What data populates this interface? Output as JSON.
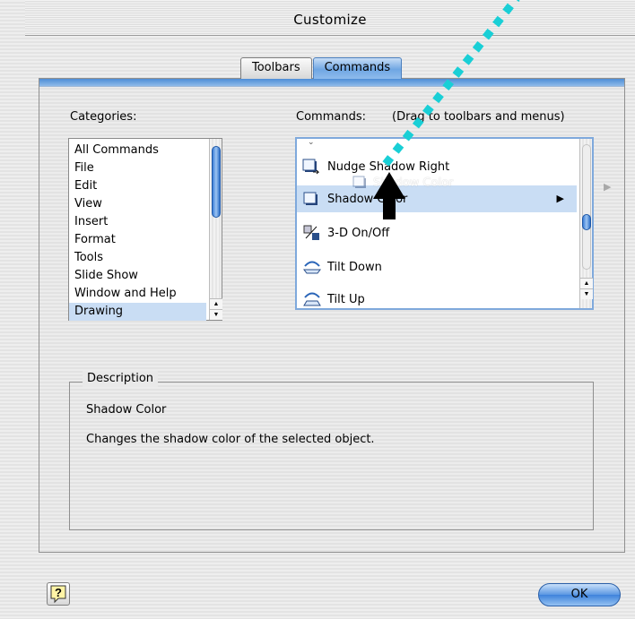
{
  "window": {
    "title": "Customize"
  },
  "tabs": [
    {
      "label": "Toolbars",
      "active": false
    },
    {
      "label": "Commands",
      "active": true
    }
  ],
  "categories": {
    "label": "Categories:",
    "items": [
      "All Commands",
      "File",
      "Edit",
      "View",
      "Insert",
      "Format",
      "Tools",
      "Slide Show",
      "Window and Help",
      "Drawing"
    ],
    "selected": "Drawing"
  },
  "commands": {
    "label": "Commands:",
    "hint": "(Drag to toolbars and menus)",
    "items": [
      {
        "label": "Nudge Shadow Right",
        "icon": "nudge-shadow-right-icon"
      },
      {
        "label": "Shadow Color",
        "icon": "shadow-color-icon",
        "has_submenu": true,
        "selected": true
      },
      {
        "label": "3-D On/Off",
        "icon": "3d-icon"
      },
      {
        "label": "Tilt Down",
        "icon": "tilt-down-icon"
      },
      {
        "label": "Tilt Up",
        "icon": "tilt-up-icon"
      }
    ],
    "drag_ghost_label": "Shadow Color"
  },
  "description": {
    "legend": "Description",
    "name": "Shadow Color",
    "text": "Changes the shadow color of the selected object."
  },
  "buttons": {
    "ok": "OK",
    "help": "?"
  },
  "colors": {
    "accent": "#5a97e2",
    "selection": "#c9ddf4",
    "drag_path": "#19cfd6"
  }
}
